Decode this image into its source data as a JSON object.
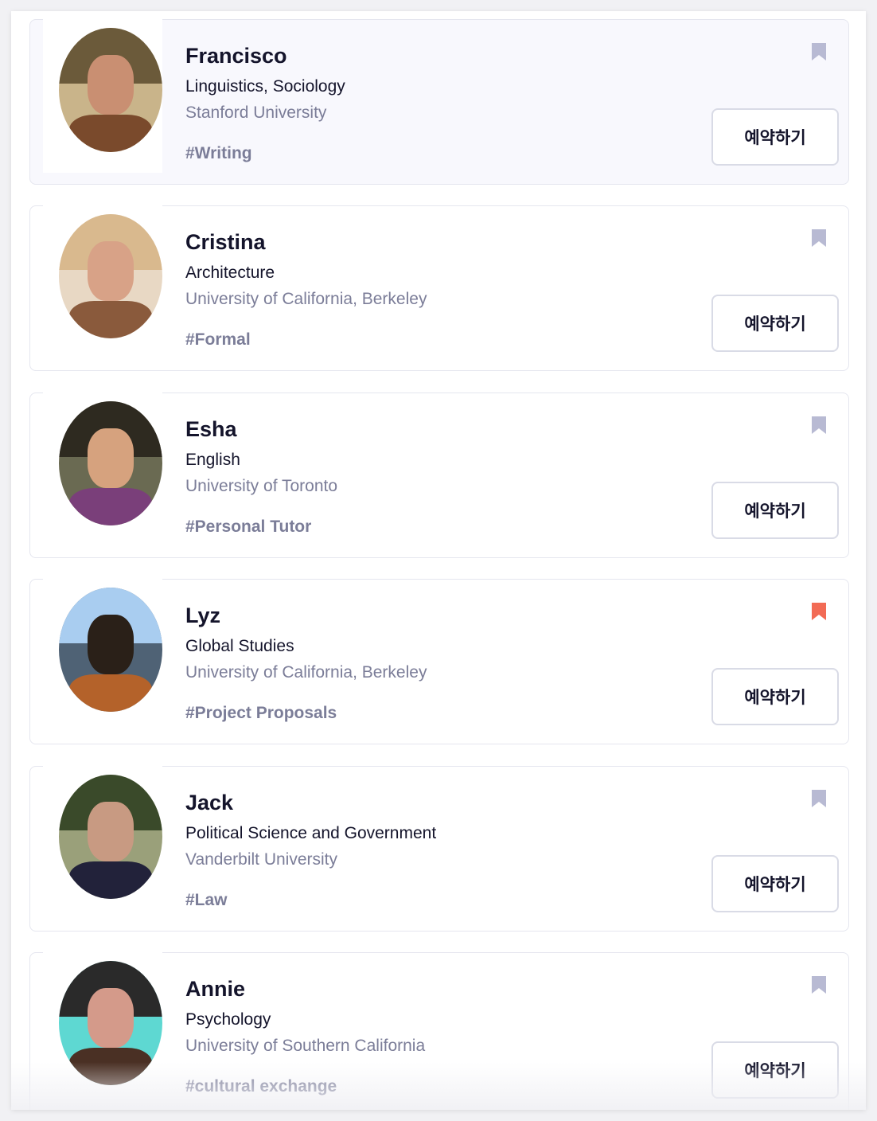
{
  "colors": {
    "bookmark_off": "#b8bad3",
    "bookmark_on": "#f26b55",
    "name_text": "#14142b",
    "muted_text": "#7b7d98"
  },
  "tutors": [
    {
      "name": "Francisco",
      "major": "Linguistics, Sociology",
      "school": "Stanford University",
      "tag": "#Writing",
      "button_label": "예약하기",
      "bookmarked": false,
      "selected": true,
      "avatar_icon": "tutor-photo"
    },
    {
      "name": "Cristina",
      "major": "Architecture",
      "school": "University of California, Berkeley",
      "tag": "#Formal",
      "button_label": "예약하기",
      "bookmarked": false,
      "selected": false,
      "avatar_icon": "tutor-photo"
    },
    {
      "name": "Esha",
      "major": "English",
      "school": "University of Toronto",
      "tag": "#Personal Tutor",
      "button_label": "예약하기",
      "bookmarked": false,
      "selected": false,
      "avatar_icon": "tutor-photo"
    },
    {
      "name": "Lyz",
      "major": "Global Studies",
      "school": "University of California, Berkeley",
      "tag": "#Project Proposals",
      "button_label": "예약하기",
      "bookmarked": true,
      "selected": false,
      "avatar_icon": "tutor-photo"
    },
    {
      "name": "Jack",
      "major": "Political Science and Government",
      "school": "Vanderbilt University",
      "tag": "#Law",
      "button_label": "예약하기",
      "bookmarked": false,
      "selected": false,
      "avatar_icon": "tutor-photo"
    },
    {
      "name": "Annie",
      "major": "Psychology",
      "school": "University of Southern California",
      "tag": "#cultural exchange",
      "button_label": "예약하기",
      "bookmarked": false,
      "selected": false,
      "avatar_icon": "tutor-photo"
    }
  ]
}
